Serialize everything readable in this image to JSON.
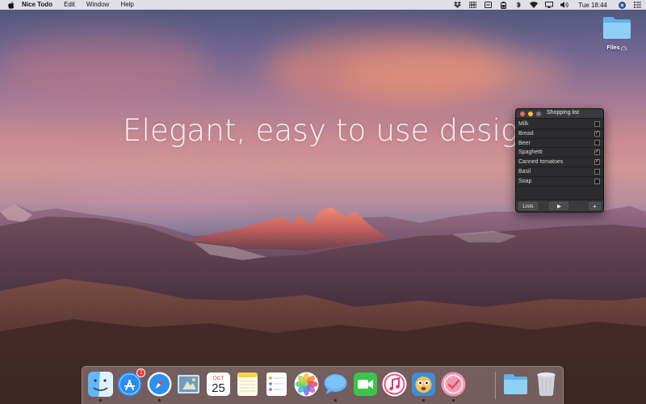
{
  "menubar": {
    "app_name": "Nice Todo",
    "menus": [
      "Edit",
      "Window",
      "Help"
    ],
    "clock": "Tue 18:44",
    "status_icons": [
      "dropbox-icon",
      "grid-icon",
      "vpn-icon",
      "battery-icon",
      "bluetooth-icon",
      "wifi-icon",
      "airplay-icon",
      "volume-icon",
      "clock-label",
      "user-icon",
      "list-icon"
    ]
  },
  "desktop": {
    "folder_label": "Files",
    "headline": "Elegant, easy to use design"
  },
  "todo": {
    "title": "Shopping list",
    "items": [
      {
        "label": "Milk",
        "checked": false
      },
      {
        "label": "Bread",
        "checked": true
      },
      {
        "label": "Beer",
        "checked": false
      },
      {
        "label": "Spaghetti",
        "checked": true
      },
      {
        "label": "Canned tomatoes",
        "checked": true
      },
      {
        "label": "Basil",
        "checked": false
      },
      {
        "label": "Soap",
        "checked": false
      }
    ],
    "lists_button": "Lists",
    "add_button": "+",
    "check_mark": "✓"
  },
  "dock": {
    "apps": [
      {
        "name": "Finder",
        "icon": "finder-icon",
        "running": true
      },
      {
        "name": "App Store",
        "icon": "app-store-icon",
        "running": false,
        "badge": "1"
      },
      {
        "name": "Safari",
        "icon": "safari-icon",
        "running": true
      },
      {
        "name": "Mail",
        "icon": "mail-icon",
        "running": false
      },
      {
        "name": "Calendar",
        "icon": "calendar-icon",
        "running": false,
        "month": "OCT",
        "day": "25"
      },
      {
        "name": "Notes",
        "icon": "notes-icon",
        "running": false
      },
      {
        "name": "Reminders",
        "icon": "reminders-icon",
        "running": false
      },
      {
        "name": "Photos",
        "icon": "photos-icon",
        "running": false
      },
      {
        "name": "Messages",
        "icon": "messages-icon",
        "running": true
      },
      {
        "name": "FaceTime",
        "icon": "facetime-icon",
        "running": false
      },
      {
        "name": "iTunes",
        "icon": "itunes-icon",
        "running": false
      },
      {
        "name": "Tweetbot",
        "icon": "tweetbot-icon",
        "running": true
      },
      {
        "name": "Nice Todo",
        "icon": "nice-todo-icon",
        "running": true
      },
      {
        "name": "Downloads",
        "icon": "folder-icon",
        "running": false
      },
      {
        "name": "Trash",
        "icon": "trash-icon",
        "running": false
      }
    ]
  },
  "colors": {
    "close": "#ff5f57",
    "minimize": "#febc2e",
    "zoom": "#7a7a7a",
    "badge": "#f0302e"
  }
}
